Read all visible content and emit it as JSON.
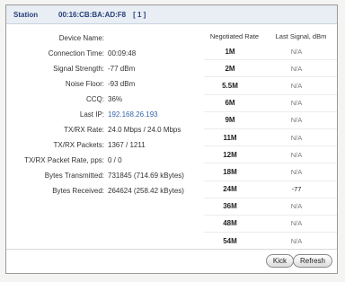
{
  "station": {
    "label": "Station",
    "mac": "00:16:CB:BA:AD:F8",
    "index": "[ 1 ]"
  },
  "info": [
    {
      "label": "Device Name:",
      "value": ""
    },
    {
      "label": "Connection Time:",
      "value": "00:09:48"
    },
    {
      "label": "Signal Strength:",
      "value": "-77 dBm"
    },
    {
      "label": "Noise Floor:",
      "value": "-93 dBm"
    },
    {
      "label": "CCQ:",
      "value": "36%"
    },
    {
      "label": "Last IP:",
      "value": "192.168.26.193"
    },
    {
      "label": "TX/RX Rate:",
      "value": "24.0 Mbps / 24.0 Mbps"
    },
    {
      "label": "TX/RX Packets:",
      "value": "1367 / 1211"
    },
    {
      "label": "TX/RX Packet Rate, pps:",
      "value": "0 / 0"
    },
    {
      "label": "Bytes Transmitted:",
      "value": "731845 (714.69 kBytes)"
    },
    {
      "label": "Bytes Received:",
      "value": "264624 (258.42 kBytes)"
    }
  ],
  "rates": {
    "col_rate": "Negotiated Rate",
    "col_signal": "Last Signal, dBm",
    "rows": [
      {
        "rate": "1M",
        "signal": "N/A"
      },
      {
        "rate": "2M",
        "signal": "N/A"
      },
      {
        "rate": "5.5M",
        "signal": "N/A"
      },
      {
        "rate": "6M",
        "signal": "N/A"
      },
      {
        "rate": "9M",
        "signal": "N/A"
      },
      {
        "rate": "11M",
        "signal": "N/A"
      },
      {
        "rate": "12M",
        "signal": "N/A"
      },
      {
        "rate": "18M",
        "signal": "N/A"
      },
      {
        "rate": "24M",
        "signal": "-77"
      },
      {
        "rate": "36M",
        "signal": "N/A"
      },
      {
        "rate": "48M",
        "signal": "N/A"
      },
      {
        "rate": "54M",
        "signal": "N/A"
      }
    ]
  },
  "buttons": {
    "kick": "Kick",
    "refresh": "Refresh"
  },
  "colors": {
    "title_text": "#27407a",
    "link": "#3366aa",
    "na_text": "#7a7a7a"
  }
}
